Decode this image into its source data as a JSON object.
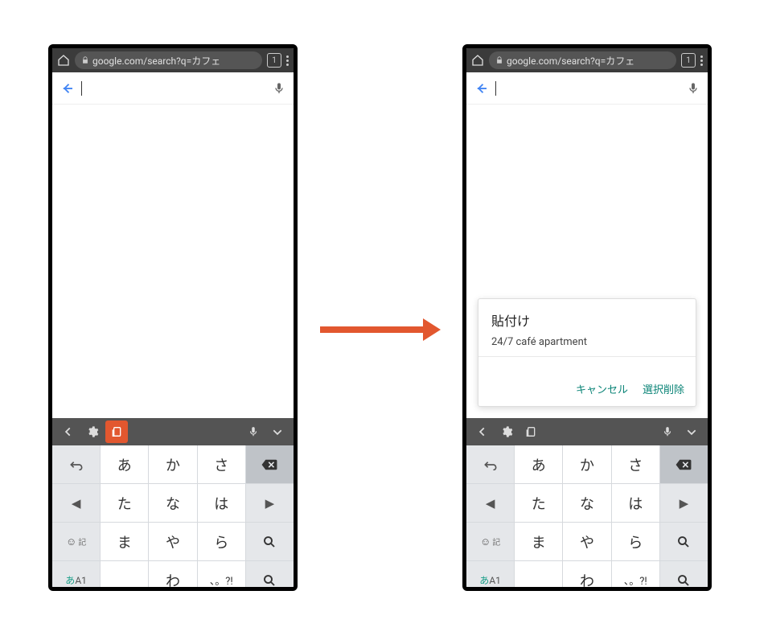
{
  "browser": {
    "url": "google.com/search?q=カフェ",
    "tab_count": "1"
  },
  "search": {
    "value": ""
  },
  "paste_dialog": {
    "title": "貼付け",
    "clipboard_text": "24/7 café apartment",
    "cancel": "キャンセル",
    "delete_selection": "選択削除"
  },
  "keyboard": {
    "rows": [
      [
        "あ",
        "か",
        "さ"
      ],
      [
        "た",
        "な",
        "は"
      ],
      [
        "ま",
        "や",
        "ら"
      ],
      [
        "",
        "わ",
        "、。?!"
      ]
    ],
    "ime_label": "あA1",
    "emoji_label": "記",
    "space_glyph": "⌴"
  }
}
